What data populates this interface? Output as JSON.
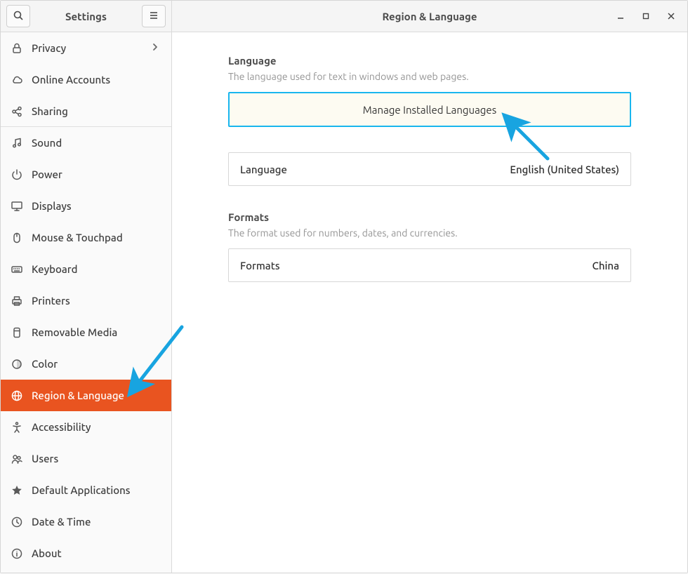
{
  "header": {
    "sidebar_title": "Settings",
    "main_title": "Region & Language"
  },
  "sidebar": {
    "items": [
      {
        "key": "privacy",
        "label": "Privacy",
        "icon": "lock",
        "chevron": true,
        "separator": false,
        "active": false
      },
      {
        "key": "online-accounts",
        "label": "Online Accounts",
        "icon": "cloud",
        "chevron": false,
        "separator": false,
        "active": false
      },
      {
        "key": "sharing",
        "label": "Sharing",
        "icon": "share",
        "chevron": false,
        "separator": true,
        "active": false
      },
      {
        "key": "sound",
        "label": "Sound",
        "icon": "music",
        "chevron": false,
        "separator": false,
        "active": false
      },
      {
        "key": "power",
        "label": "Power",
        "icon": "power",
        "chevron": false,
        "separator": false,
        "active": false
      },
      {
        "key": "displays",
        "label": "Displays",
        "icon": "display",
        "chevron": false,
        "separator": false,
        "active": false
      },
      {
        "key": "mouse-touchpad",
        "label": "Mouse & Touchpad",
        "icon": "mouse",
        "chevron": false,
        "separator": false,
        "active": false
      },
      {
        "key": "keyboard",
        "label": "Keyboard",
        "icon": "keyboard",
        "chevron": false,
        "separator": false,
        "active": false
      },
      {
        "key": "printers",
        "label": "Printers",
        "icon": "printer",
        "chevron": false,
        "separator": false,
        "active": false
      },
      {
        "key": "removable-media",
        "label": "Removable Media",
        "icon": "usb",
        "chevron": false,
        "separator": false,
        "active": false
      },
      {
        "key": "color",
        "label": "Color",
        "icon": "color",
        "chevron": false,
        "separator": false,
        "active": false
      },
      {
        "key": "region-language",
        "label": "Region & Language",
        "icon": "globe",
        "chevron": false,
        "separator": false,
        "active": true
      },
      {
        "key": "accessibility",
        "label": "Accessibility",
        "icon": "accessibility",
        "chevron": false,
        "separator": false,
        "active": false
      },
      {
        "key": "users",
        "label": "Users",
        "icon": "users",
        "chevron": false,
        "separator": false,
        "active": false
      },
      {
        "key": "default-apps",
        "label": "Default Applications",
        "icon": "star",
        "chevron": false,
        "separator": false,
        "active": false
      },
      {
        "key": "date-time",
        "label": "Date & Time",
        "icon": "clock",
        "chevron": false,
        "separator": false,
        "active": false
      },
      {
        "key": "about",
        "label": "About",
        "icon": "info",
        "chevron": false,
        "separator": false,
        "active": false
      }
    ]
  },
  "main": {
    "language": {
      "title": "Language",
      "subtitle": "The language used for text in windows and web pages.",
      "manage_button": "Manage Installed Languages",
      "row_key": "Language",
      "row_value": "English (United States)"
    },
    "formats": {
      "title": "Formats",
      "subtitle": "The format used for numbers, dates, and currencies.",
      "row_key": "Formats",
      "row_value": "China"
    }
  }
}
